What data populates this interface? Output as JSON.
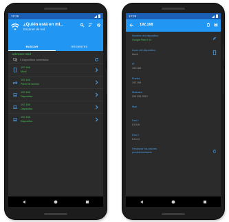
{
  "left_phone": {
    "status_time": "12:26",
    "app_title": "¿Quién está en mi...",
    "app_subtitle": "Escáner de red",
    "tabs": [
      {
        "label": "BUSCAR",
        "active": true
      },
      {
        "label": "RECIENTES",
        "active": false
      }
    ],
    "network_name": "unknown ssid",
    "devices_count": "5 Dispositivos conectados",
    "devices": [
      {
        "ip": "192.168",
        "kind": "Móvil",
        "icon": "phone-icon"
      },
      {
        "ip": "192.168",
        "kind": "Punto de acceso",
        "icon": "router-icon"
      },
      {
        "ip": "192.168",
        "kind": "Dispositivo",
        "icon": "laptop-icon"
      },
      {
        "ip": "192.168",
        "kind": "Dispositivo",
        "icon": "laptop-icon"
      },
      {
        "ip": "192.168",
        "kind": "Dispositivo",
        "icon": "laptop-icon"
      }
    ]
  },
  "right_phone": {
    "status_time": "12:26",
    "title": "192.168",
    "details": [
      {
        "label": "Nombre del dispositivo",
        "value": "Google Pixel 3 XL",
        "green": true,
        "action_icon": "edit-icon"
      },
      {
        "label": "Icono del dispositivo",
        "value": "Móvil",
        "green": false,
        "action_icon": "phone-icon"
      },
      {
        "label": "IP",
        "value": "192.168",
        "green": false,
        "action_icon": ""
      },
      {
        "label": "Puerta",
        "value": "192.168",
        "green": false,
        "action_icon": ""
      },
      {
        "label": "Máscara",
        "value": "255.255.255.0",
        "green": false,
        "action_icon": ""
      },
      {
        "label": "Mac",
        "value": "",
        "green": false,
        "action_icon": ""
      },
      {
        "label": "Dns 1",
        "value": "8.8.8.8",
        "green": false,
        "action_icon": ""
      },
      {
        "label": "Dns 2",
        "value": "8.8.4.4",
        "green": false,
        "action_icon": ""
      },
      {
        "label": "Restaurar los valores predeterminados",
        "value": "",
        "green": false,
        "action_icon": "refresh-icon"
      }
    ]
  },
  "colors": {
    "accent": "#2196f3",
    "status_bar": "#1a5fb4",
    "screen_bg": "#2b2b2b",
    "green_text": "#4cc15a",
    "label_blue": "#4a9fe9"
  }
}
